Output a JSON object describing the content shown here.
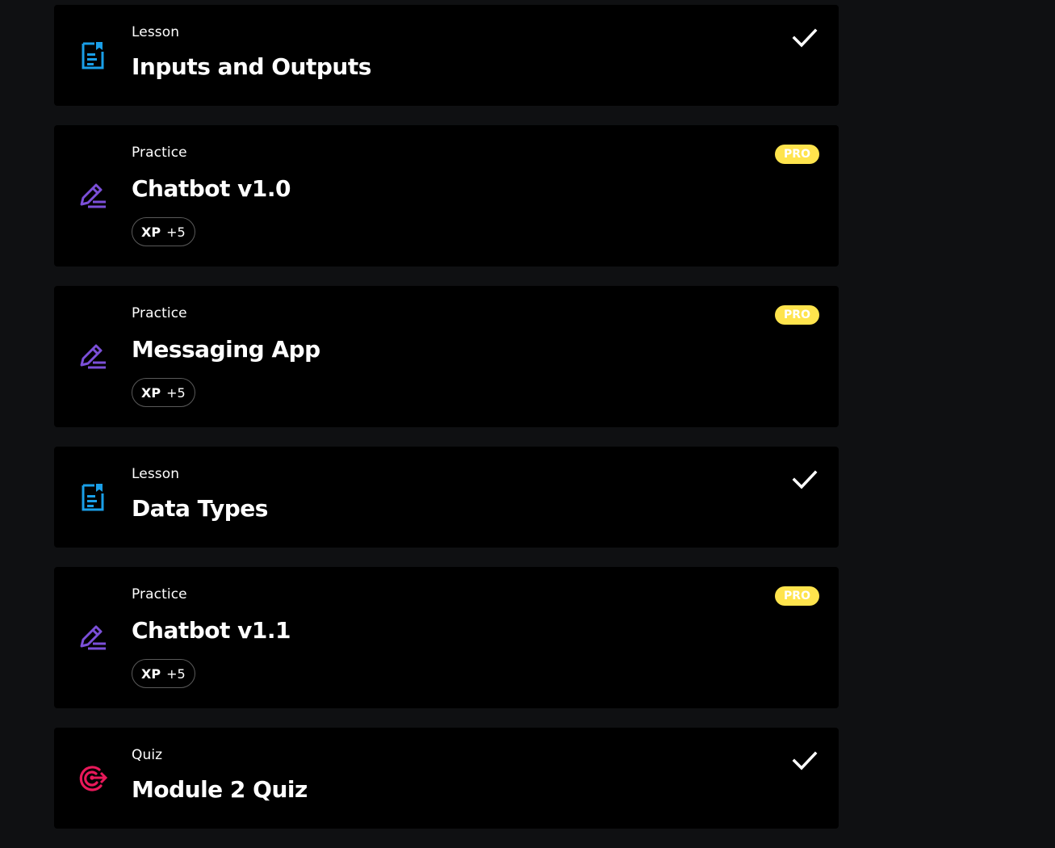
{
  "items": [
    {
      "kind": "lesson",
      "type": "Lesson",
      "title": "Inputs and Outputs",
      "completed": true
    },
    {
      "kind": "practice",
      "type": "Practice",
      "title": "Chatbot v1.0",
      "badge": "PRO",
      "xp_label": "XP",
      "xp_value": "+5"
    },
    {
      "kind": "practice",
      "type": "Practice",
      "title": "Messaging App",
      "badge": "PRO",
      "xp_label": "XP",
      "xp_value": "+5"
    },
    {
      "kind": "lesson",
      "type": "Lesson",
      "title": "Data Types",
      "completed": true
    },
    {
      "kind": "practice",
      "type": "Practice",
      "title": "Chatbot v1.1",
      "badge": "PRO",
      "xp_label": "XP",
      "xp_value": "+5"
    },
    {
      "kind": "quiz",
      "type": "Quiz",
      "title": "Module 2 Quiz",
      "completed": true
    }
  ],
  "icons": {
    "lesson": "document-icon",
    "practice": "pencil-icon",
    "quiz": "target-icon",
    "completed": "checkmark-icon"
  },
  "colors": {
    "lesson_icon": "#1a9fe8",
    "practice_icon": "#7b4fd8",
    "quiz_icon": "#e8195a",
    "pro_badge": "#ffe44d",
    "card_bg": "#000000",
    "page_bg": "#0f1012"
  }
}
